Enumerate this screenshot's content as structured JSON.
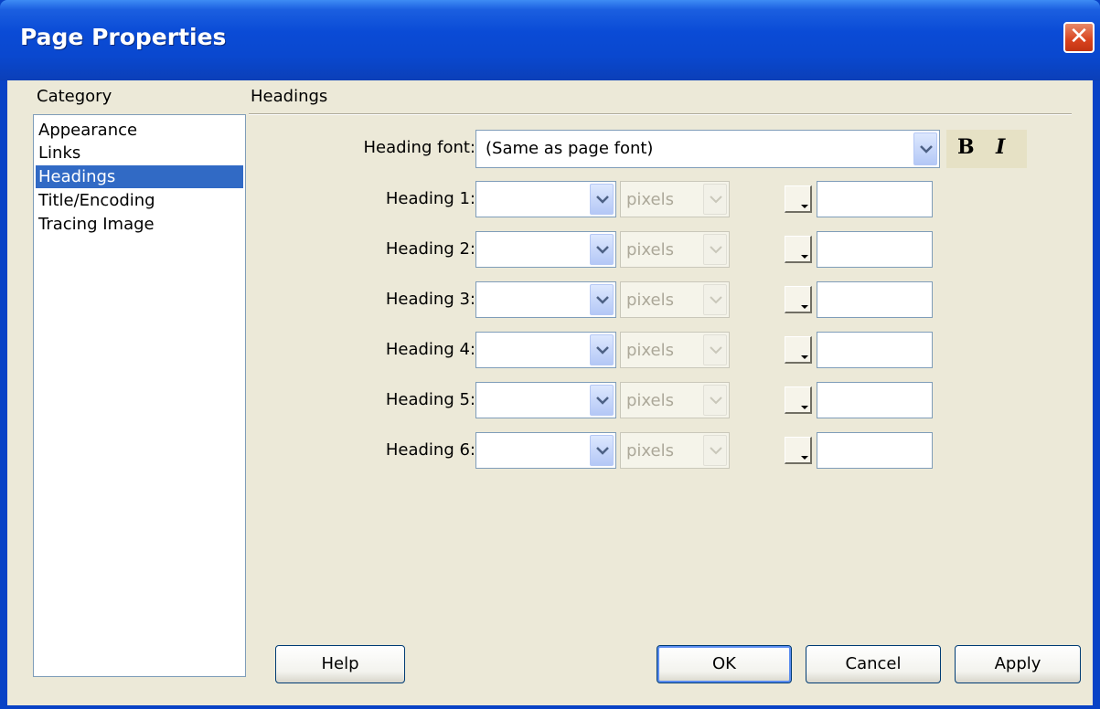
{
  "window": {
    "title": "Page Properties",
    "close_symbol": "✕"
  },
  "sidebar": {
    "label": "Category",
    "items": [
      {
        "label": "Appearance",
        "selected": false
      },
      {
        "label": "Links",
        "selected": false
      },
      {
        "label": "Headings",
        "selected": true
      },
      {
        "label": "Title/Encoding",
        "selected": false
      },
      {
        "label": "Tracing Image",
        "selected": false
      }
    ]
  },
  "main": {
    "section_title": "Headings",
    "heading_font": {
      "label": "Heading font:",
      "value": "(Same as page font)"
    },
    "style_buttons": {
      "bold": "B",
      "italic": "I"
    },
    "headings": [
      {
        "label": "Heading 1:",
        "size": "",
        "unit": "pixels",
        "color": ""
      },
      {
        "label": "Heading 2:",
        "size": "",
        "unit": "pixels",
        "color": ""
      },
      {
        "label": "Heading 3:",
        "size": "",
        "unit": "pixels",
        "color": ""
      },
      {
        "label": "Heading 4:",
        "size": "",
        "unit": "pixels",
        "color": ""
      },
      {
        "label": "Heading 5:",
        "size": "",
        "unit": "pixels",
        "color": ""
      },
      {
        "label": "Heading 6:",
        "size": "",
        "unit": "pixels",
        "color": ""
      }
    ]
  },
  "buttons": {
    "help": "Help",
    "ok": "OK",
    "cancel": "Cancel",
    "apply": "Apply"
  },
  "colors": {
    "titlebar": "#0a4bd6",
    "selection": "#316ac5",
    "dialog_bg": "#ece9d8"
  }
}
